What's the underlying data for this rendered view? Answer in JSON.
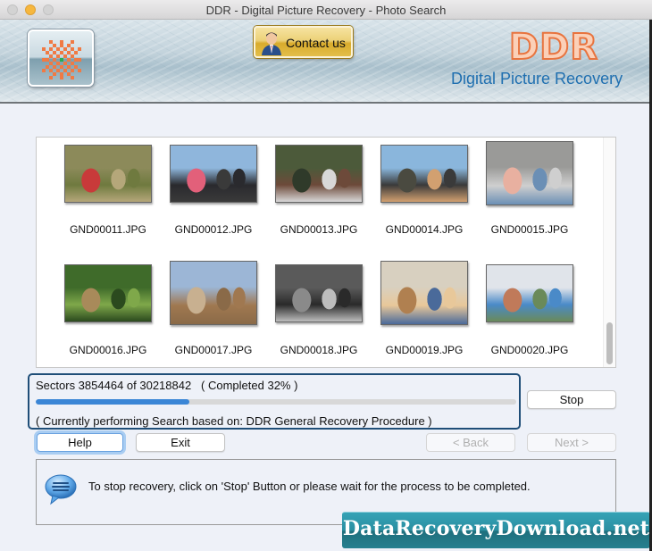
{
  "window": {
    "title": "DDR - Digital Picture Recovery - Photo Search"
  },
  "banner": {
    "contact_label": "Contact us",
    "brand_name": "DDR",
    "brand_subtitle": "Digital Picture Recovery"
  },
  "thumbnails": [
    {
      "name": "GND00011.JPG",
      "palette": [
        "#8c8a5a",
        "#6f7a3f",
        "#b5a77a",
        "#c83a3a"
      ]
    },
    {
      "name": "GND00012.JPG",
      "palette": [
        "#8fb6dc",
        "#2a2a2e",
        "#3a3a3a",
        "#e2607a"
      ]
    },
    {
      "name": "GND00013.JPG",
      "palette": [
        "#4c5a3a",
        "#6d4a3a",
        "#d8d8d8",
        "#2f3a2a"
      ]
    },
    {
      "name": "GND00014.JPG",
      "palette": [
        "#8ab6dc",
        "#3a3a3a",
        "#d2a070",
        "#4a4a40"
      ]
    },
    {
      "name": "GND00015.JPG",
      "palette": [
        "#9a9a98",
        "#cfcfcf",
        "#6b8fb5",
        "#e8b0a0"
      ]
    },
    {
      "name": "GND00016.JPG",
      "palette": [
        "#3f6b2a",
        "#7fa84a",
        "#2b4a1e",
        "#a88a5a"
      ]
    },
    {
      "name": "GND00017.JPG",
      "palette": [
        "#9cb6d6",
        "#a07850",
        "#8a6a48",
        "#c8b090"
      ]
    },
    {
      "name": "GND00018.JPG",
      "palette": [
        "#5a5a5a",
        "#2a2a2a",
        "#bdbdbd",
        "#8a8a8a"
      ]
    },
    {
      "name": "GND00019.JPG",
      "palette": [
        "#d8d0c0",
        "#e8c89a",
        "#4a6a9a",
        "#b08050"
      ]
    },
    {
      "name": "GND00020.JPG",
      "palette": [
        "#e0e4ea",
        "#4a8ac8",
        "#6a8a5a",
        "#c07a5a"
      ]
    }
  ],
  "progress": {
    "sectors_text": "Sectors 3854464 of 30218842",
    "completed_text": "( Completed 32% )",
    "percent": 32,
    "status_text": "( Currently performing Search based on: DDR General Recovery Procedure )"
  },
  "buttons": {
    "stop": "Stop",
    "help": "Help",
    "exit": "Exit",
    "back": "< Back",
    "next": "Next >"
  },
  "message": {
    "text": "To stop recovery, click on 'Stop' Button or please wait for the process to be completed."
  },
  "watermark": {
    "text": "DataRecoveryDownload.net"
  }
}
